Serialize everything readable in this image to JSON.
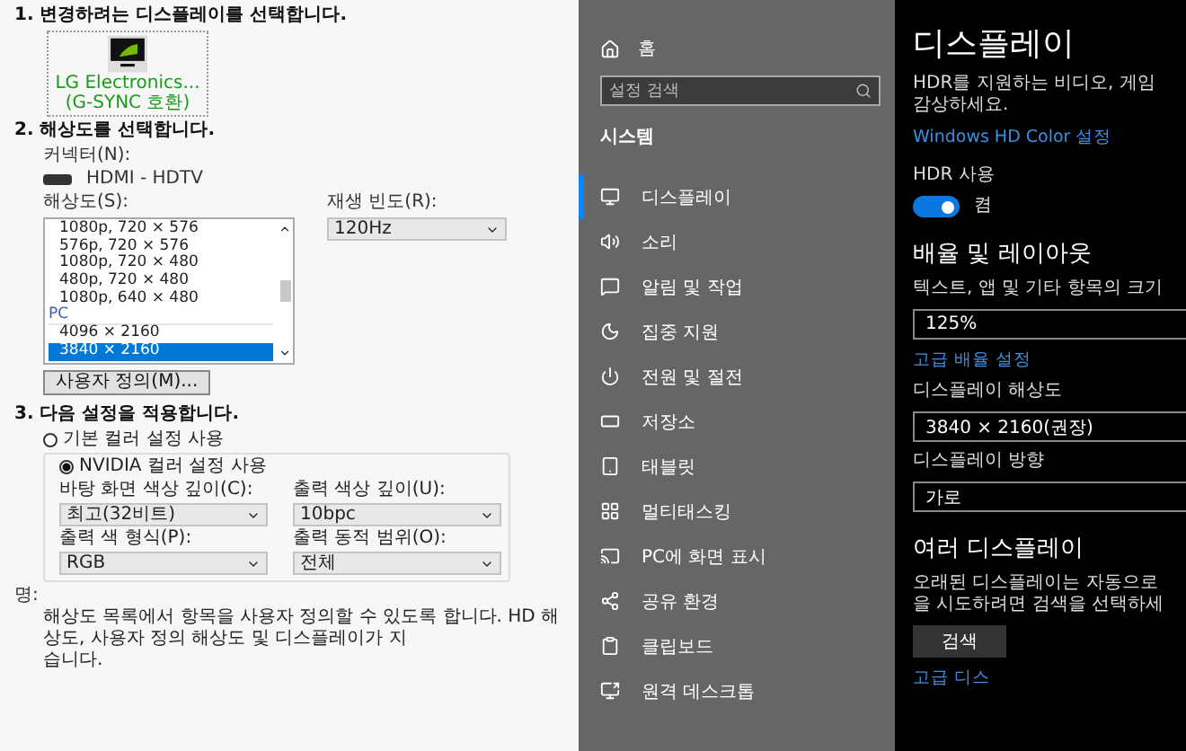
{
  "nvidia_panel": {
    "step1_heading": "1. 변경하려는 디스플레이를 선택합니다.",
    "displays": [
      {
        "label": "LG Electronics...",
        "sublabel": "(G-SYNC 호환)",
        "selected": true
      }
    ],
    "step2_heading": "2. 해상도를 선택합니다.",
    "connector_label": "커넥터(N):",
    "connector_value": "HDMI - HDTV",
    "resolution_label": "해상도(S):",
    "resolutions": [
      {
        "kind": "item",
        "label": "1080p, 720 × 576",
        "selected": false
      },
      {
        "kind": "item",
        "label": "576p, 720 × 576",
        "selected": false
      },
      {
        "kind": "item",
        "label": "1080p, 720 × 480",
        "selected": false
      },
      {
        "kind": "item",
        "label": "480p, 720 × 480",
        "selected": false
      },
      {
        "kind": "item",
        "label": "1080p, 640 × 480",
        "selected": false
      },
      {
        "kind": "group",
        "label": "PC"
      },
      {
        "kind": "item",
        "label": "4096 × 2160",
        "selected": false
      },
      {
        "kind": "item",
        "label": "3840 × 2160",
        "selected": true
      }
    ],
    "refresh_label": "재생 빈도(R):",
    "refresh_value": "120Hz",
    "customize_button": "사용자 정의(M)...",
    "step3_heading": "3. 다음 설정을 적용합니다.",
    "color_options": [
      {
        "label": "기본 컬러 설정 사용",
        "selected": false
      },
      {
        "label": "NVIDIA 컬러 설정 사용",
        "selected": true
      }
    ],
    "color_fields": [
      {
        "label": "바탕 화면 색상 깊이(C):",
        "value": "최고(32비트)"
      },
      {
        "label": "출력 색상 깊이(U):",
        "value": "10bpc"
      },
      {
        "label": "출력 색 형식(P):",
        "value": "RGB"
      },
      {
        "label": "출력 동적 범위(O):",
        "value": "전체"
      }
    ],
    "description_label": "명:",
    "description_lines": [
      "해상도 목록에서 항목을 사용자 정의할 수 있도록 합니다. HD 해상도, 사용자 정의 해상도 및 디스플레이가 지",
      "습니다."
    ]
  },
  "settings_sidebar": {
    "home_label": "홈",
    "search": {
      "placeholder": "설정 검색"
    },
    "section_title": "시스템",
    "items": [
      {
        "label": "디스플레이",
        "selected": true
      },
      {
        "label": "소리",
        "selected": false
      },
      {
        "label": "알림 및 작업",
        "selected": false
      },
      {
        "label": "집중 지원",
        "selected": false
      },
      {
        "label": "전원 및 절전",
        "selected": false
      },
      {
        "label": "저장소",
        "selected": false
      },
      {
        "label": "태블릿",
        "selected": false
      },
      {
        "label": "멀티태스킹",
        "selected": false
      },
      {
        "label": "PC에 화면 표시",
        "selected": false
      },
      {
        "label": "공유 환경",
        "selected": false
      },
      {
        "label": "클립보드",
        "selected": false
      },
      {
        "label": "원격 데스크톱",
        "selected": false
      }
    ]
  },
  "display_settings": {
    "title": "디스플레이",
    "hdr_description_lines": [
      "HDR를 지원하는 비디오, 게임",
      "감상하세요."
    ],
    "hd_color_link": "Windows HD Color 설정",
    "hdr_toggle": {
      "label": "HDR 사용",
      "on": true,
      "state_text": "켬"
    },
    "scale_heading": "배율 및 레이아웃",
    "scale_label": "텍스트, 앱 및 기타 항목의 크기",
    "scale_value": "125%",
    "advanced_scaling_link": "고급 배율 설정",
    "resolution_label": "디스플레이 해상도",
    "resolution_value": "3840 × 2160(권장)",
    "orientation_label": "디스플레이 방향",
    "orientation_value": "가로",
    "multi_heading": "여러 디스플레이",
    "multi_description_lines": [
      "오래된 디스플레이는 자동으로",
      "을 시도하려면 검색을 선택하세"
    ],
    "detect_button": "검색",
    "advanced_display_link": "고급 디스"
  }
}
